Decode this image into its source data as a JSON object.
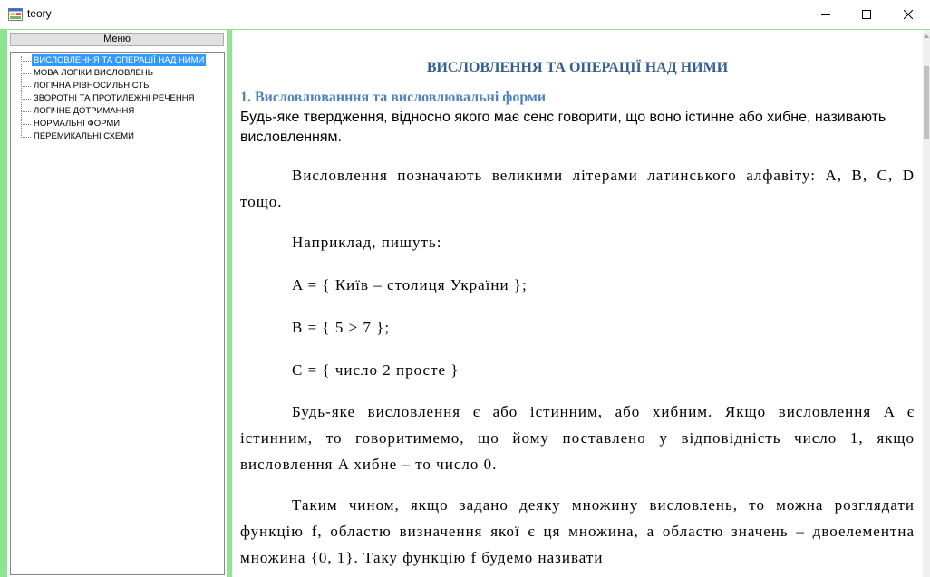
{
  "window": {
    "title": "teory",
    "icon": "app-window-icon",
    "minimize_icon": "minimize-icon",
    "maximize_icon": "maximize-icon",
    "close_icon": "close-icon"
  },
  "sidebar": {
    "menu_button_label": "Меню",
    "items": [
      {
        "label": "ВИСЛОВЛЕННЯ ТА ОПЕРАЦІЇ НАД НИМИ",
        "selected": true
      },
      {
        "label": "МОВА ЛОГІКИ ВИСЛОВЛЕНЬ",
        "selected": false
      },
      {
        "label": "ЛОГІЧНА РІВНОСИЛЬНІСТЬ",
        "selected": false
      },
      {
        "label": "ЗВОРОТНІ ТА ПРОТИЛЕЖНІ РЕЧЕННЯ",
        "selected": false
      },
      {
        "label": "ЛОГІЧНЕ ДОТРИМАННЯ",
        "selected": false
      },
      {
        "label": "НОРМАЛЬНІ ФОРМИ",
        "selected": false
      },
      {
        "label": "ПЕРЕМИКАЛЬНІ СХЕМИ",
        "selected": false
      }
    ]
  },
  "document": {
    "title": "ВИСЛОВЛЕННЯ ТА ОПЕРАЦІЇ НАД НИМИ",
    "heading": "1. Висловлюванння та висловлювальні форми",
    "intro": "Будь-яке твердження, відносно якого має сенс говорити, що воно істинне або хибне, називають висловленням.",
    "paragraphs": [
      "Висловлення позначають великими літерами латинського алфавіту: A, B, C, D тощо.",
      "Наприклад, пишуть:",
      "A = { Київ – столиця України };",
      "B = { 5 > 7 };",
      "C = { число 2 просте }",
      "Будь-яке висловлення є або істинним, або хибним. Якщо висловлення A є істинним, то говоритимемо, що йому поставлено у відповідність число 1, якщо висловлення A хибне – то число 0.",
      "Таким чином, якщо задано деяку множину висловлень, то можна розглядати функцію f, областю визначення якої є ця множина, а областю значень – двоелементна множина {0, 1}. Таку функцію f будемо називати"
    ]
  },
  "colors": {
    "frame": "#8fe48f",
    "title_blue": "#365f91",
    "heading_blue": "#4f81bd",
    "selection": "#3399ff"
  }
}
